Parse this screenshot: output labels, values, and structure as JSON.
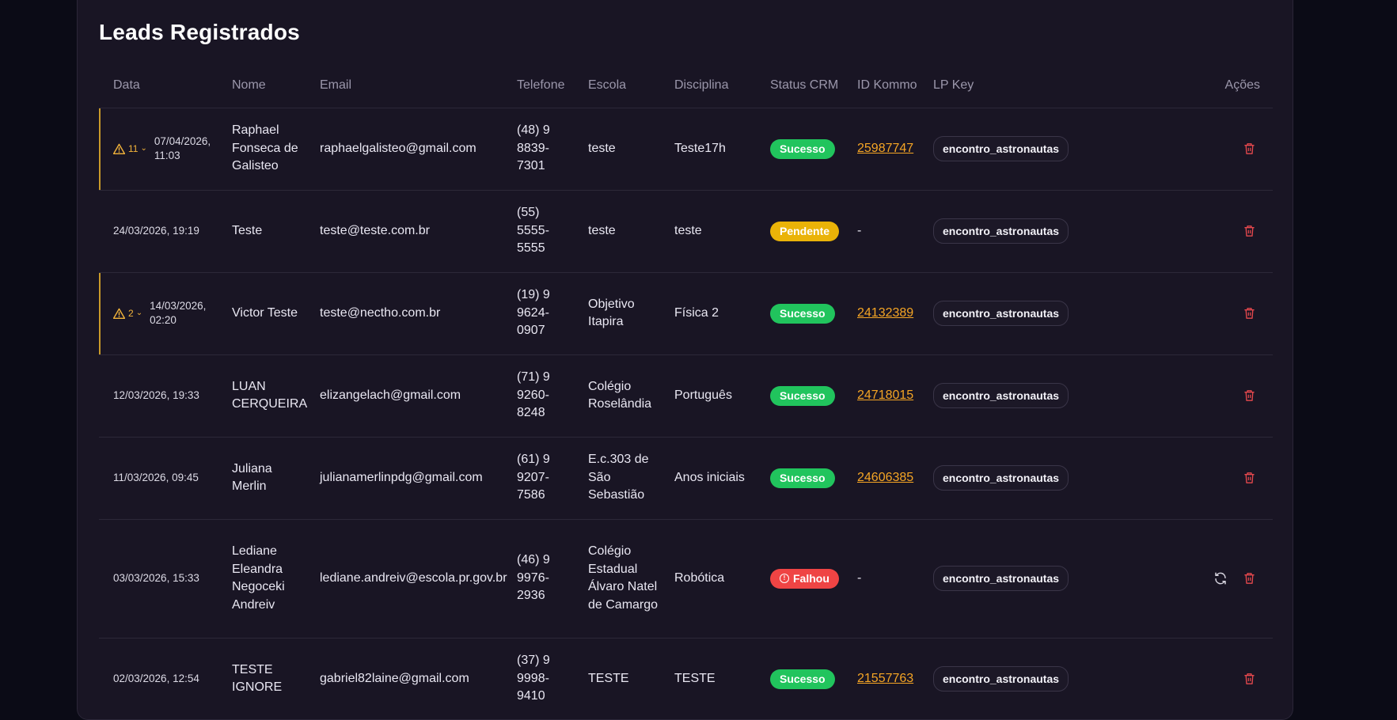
{
  "page": {
    "title": "Leads Registrados"
  },
  "colors": {
    "accent_warn": "#f3b43a",
    "success": "#21c45d",
    "pending": "#eab308",
    "failed": "#ef4444",
    "link": "#f5a524",
    "delete": "#e5484d"
  },
  "table": {
    "headers": {
      "data": "Data",
      "nome": "Nome",
      "email": "Email",
      "telefone": "Telefone",
      "escola": "Escola",
      "disciplina": "Disciplina",
      "status": "Status CRM",
      "id_kommo": "ID Kommo",
      "lp_key": "LP Key",
      "acoes": "Ações"
    },
    "rows": [
      {
        "warn": true,
        "warn_count": "11",
        "data": "07/04/2026, 11:03",
        "nome": "Raphael Fonseca de Galisteo",
        "email": "raphaelgalisteo@gmail.com",
        "telefone": "(48) 9 8839-7301",
        "escola": "teste",
        "disciplina": "Teste17h",
        "status": "Sucesso",
        "status_type": "ok",
        "id_kommo": "25987747",
        "lp_key": "encontro_astronautas",
        "retry": false
      },
      {
        "warn": false,
        "data": "24/03/2026, 19:19",
        "nome": "Teste",
        "email": "teste@teste.com.br",
        "telefone": "(55) 5555-5555",
        "escola": "teste",
        "disciplina": "teste",
        "status": "Pendente",
        "status_type": "pend",
        "id_kommo": "-",
        "lp_key": "encontro_astronautas",
        "retry": false
      },
      {
        "warn": true,
        "warn_count": "2",
        "data": "14/03/2026, 02:20",
        "nome": "Victor Teste",
        "email": "teste@nectho.com.br",
        "telefone": "(19) 9 9624-0907",
        "escola": "Objetivo Itapira",
        "disciplina": "Física 2",
        "status": "Sucesso",
        "status_type": "ok",
        "id_kommo": "24132389",
        "lp_key": "encontro_astronautas",
        "retry": false
      },
      {
        "warn": false,
        "data": "12/03/2026, 19:33",
        "nome": "LUAN CERQUEIRA",
        "email": "elizangelach@gmail.com",
        "telefone": "(71) 9 9260-8248",
        "escola": "Colégio Roselândia",
        "disciplina": "Português",
        "status": "Sucesso",
        "status_type": "ok",
        "id_kommo": "24718015",
        "lp_key": "encontro_astronautas",
        "retry": false
      },
      {
        "warn": false,
        "data": "11/03/2026, 09:45",
        "nome": "Juliana Merlin",
        "email": "julianamerlinpdg@gmail.com",
        "telefone": "(61) 9 9207-7586",
        "escola": "E.c.303 de São Sebastião",
        "disciplina": "Anos iniciais",
        "status": "Sucesso",
        "status_type": "ok",
        "id_kommo": "24606385",
        "lp_key": "encontro_astronautas",
        "retry": false
      },
      {
        "warn": false,
        "tall": true,
        "data": "03/03/2026, 15:33",
        "nome": "Lediane Eleandra Negoceki Andreiv",
        "email": "lediane.andreiv@escola.pr.gov.br",
        "telefone": "(46) 9 9976-2936",
        "escola": "Colégio Estadual Álvaro Natel de Camargo",
        "disciplina": "Robótica",
        "status": "Falhou",
        "status_type": "fail",
        "id_kommo": "-",
        "lp_key": "encontro_astronautas",
        "retry": true
      },
      {
        "warn": false,
        "data": "02/03/2026, 12:54",
        "nome": "TESTE IGNORE",
        "email": "gabriel82laine@gmail.com",
        "telefone": "(37) 9 9998-9410",
        "escola": "TESTE",
        "disciplina": "TESTE",
        "status": "Sucesso",
        "status_type": "ok",
        "id_kommo": "21557763",
        "lp_key": "encontro_astronautas",
        "retry": false
      }
    ]
  },
  "icons": {
    "warning": "warning-icon",
    "chevron": "chevron-down-icon",
    "delete": "trash-icon",
    "retry": "refresh-icon",
    "failed": "alert-circle-icon"
  }
}
